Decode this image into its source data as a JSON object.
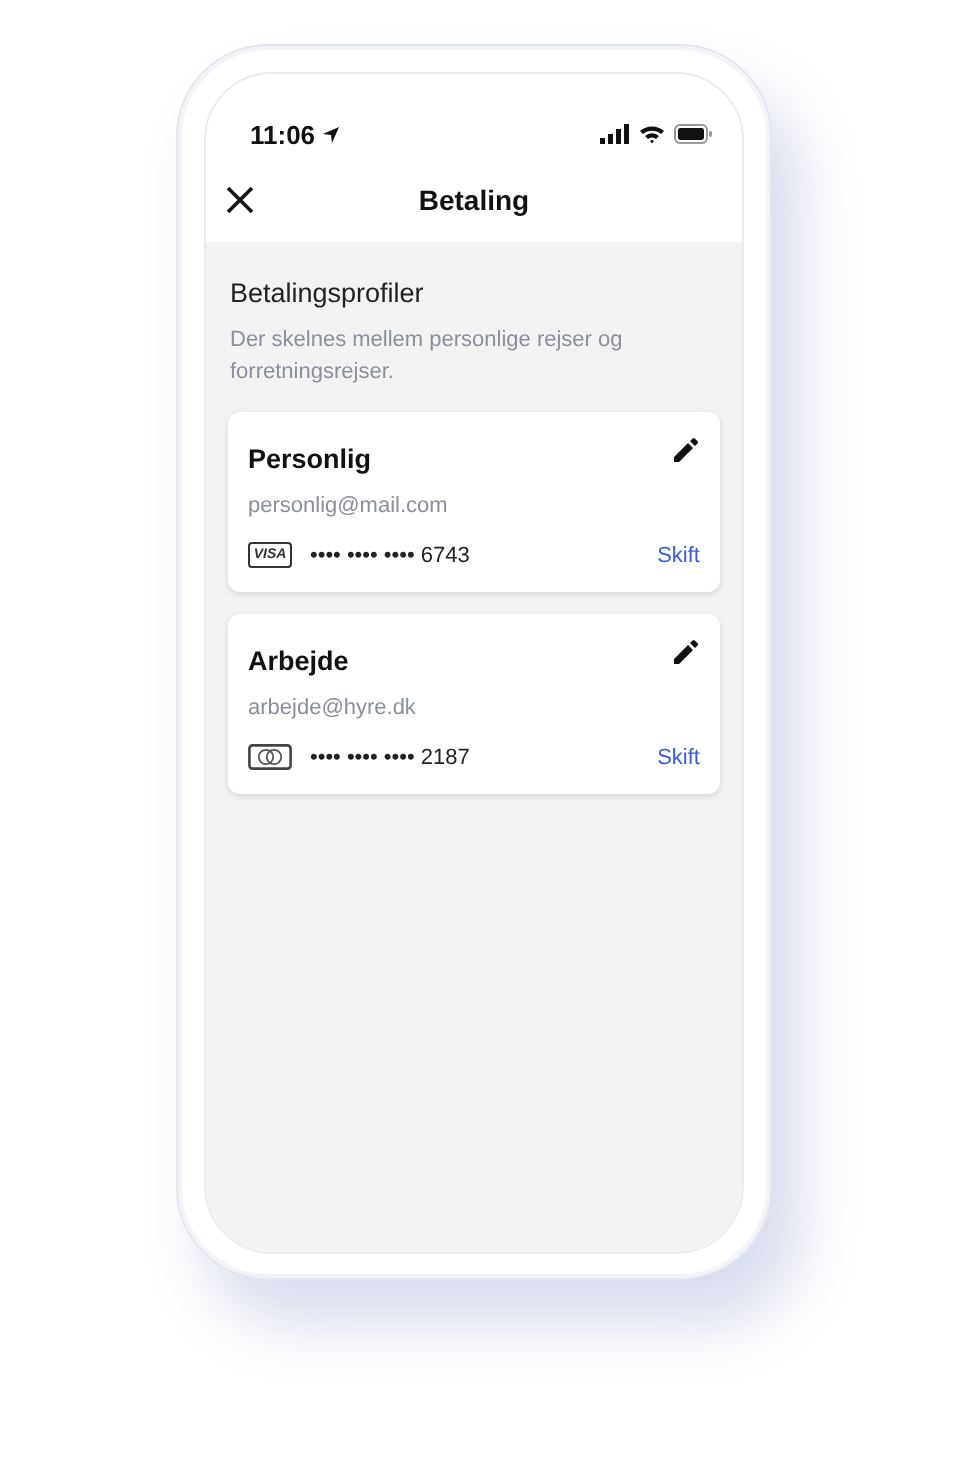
{
  "status_bar": {
    "time": "11:06"
  },
  "header": {
    "title": "Betaling"
  },
  "section": {
    "title": "Betalingsprofiler",
    "description": "Der skelnes mellem personlige rejser og forretningsrejser."
  },
  "profiles": [
    {
      "name": "Personlig",
      "email": "personlig@mail.com",
      "card": {
        "kind": "visa",
        "brand_label": "VISA",
        "number": "•••• •••• •••• 6743"
      },
      "action": "Skift"
    },
    {
      "name": "Arbejde",
      "email": "arbejde@hyre.dk",
      "card": {
        "kind": "mastercard",
        "number": "•••• •••• •••• 2187"
      },
      "action": "Skift"
    }
  ]
}
